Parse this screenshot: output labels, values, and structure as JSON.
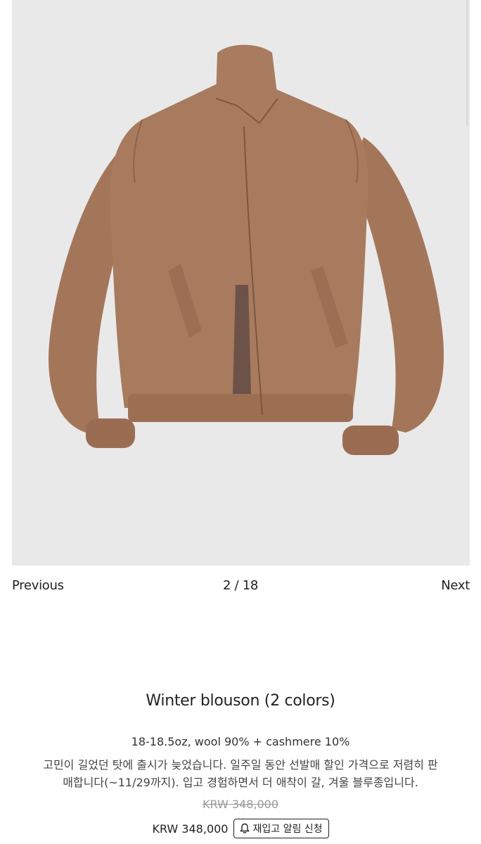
{
  "gallery": {
    "image_alt": "Winter blouson camel wool jacket",
    "previous_label": "Previous",
    "counter": "2 / 18",
    "next_label": "Next"
  },
  "product": {
    "title": "Winter blouson (2 colors)",
    "spec": "18-18.5oz, wool 90% + cashmere 10%",
    "description_line1": "고민이 길었던 탓에 출시가 늦었습니다. 일주일 동안 선발매 할인 가격으로 저렴히 판",
    "description_line2": "매합니다(~11/29까지). 입고 경험하면서 더 애착이 갈, 겨울 블루종입니다.",
    "original_price": "KRW 348,000",
    "price": "KRW 348,000",
    "restock_button_label": "재입고 알림 신청",
    "restock_icon": "bell-icon"
  },
  "colors": {
    "background": "#ffffff",
    "photo_background": "#e9e9e9",
    "jacket": "#a77a5f",
    "text": "#222222",
    "strikethrough_text": "#999999"
  }
}
